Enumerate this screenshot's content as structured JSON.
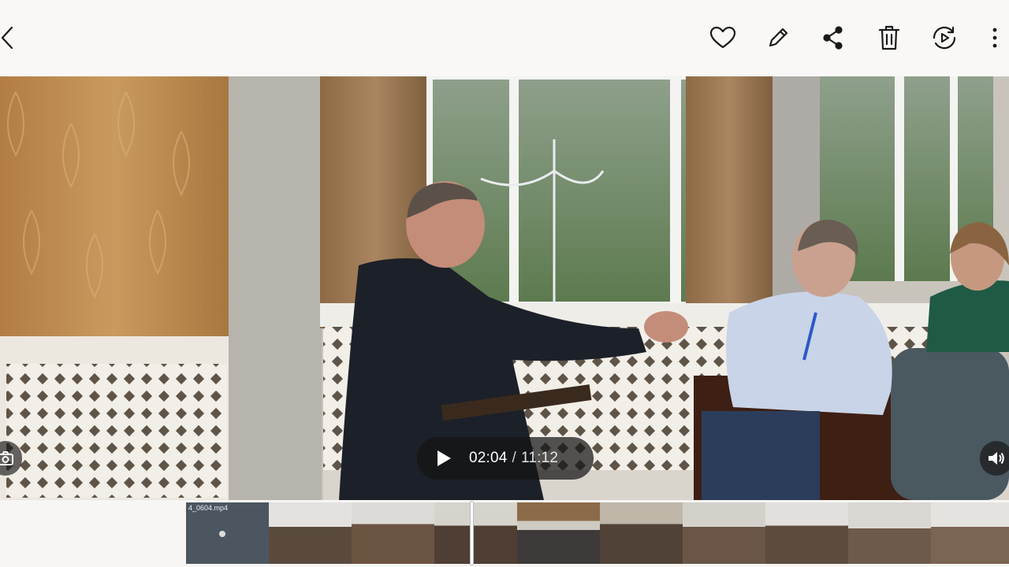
{
  "toolbar": {
    "back_icon": "chevron-left-icon",
    "favorite_icon": "heart-icon",
    "edit_icon": "pencil-icon",
    "share_icon": "share-icon",
    "delete_icon": "trash-icon",
    "convert_icon": "play-circle-arrows-icon",
    "more_icon": "more-vertical-icon"
  },
  "player": {
    "current_time": "02:04",
    "separator": "/",
    "total_time": "11:12",
    "play_icon": "play-icon",
    "capture_icon": "camera-capture-icon",
    "volume_icon": "speaker-icon",
    "progress_fraction": 0.184
  },
  "filmstrip": {
    "first_frame_label": "4_0604.mp4",
    "frame_count": 10
  },
  "colors": {
    "toolbar_bg": "#f9f8f6",
    "icon": "#1a1a1a",
    "pill_bg": "#141414"
  }
}
